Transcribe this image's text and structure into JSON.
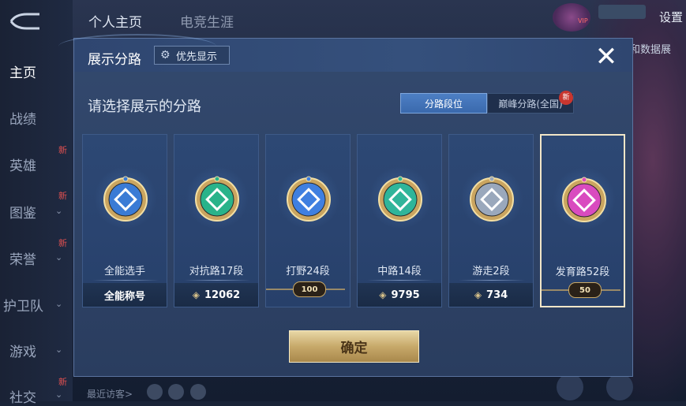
{
  "background": {
    "top_tabs": [
      "个人主页",
      "电竞生涯"
    ],
    "settings_label": "设置",
    "vip_label": "VIP",
    "data_peek": "和数据展",
    "recent_visitors": "最近访客>",
    "nav": [
      {
        "label": "主页",
        "active": true
      },
      {
        "label": "战绩"
      },
      {
        "label": "英雄",
        "new": "新"
      },
      {
        "label": "图鉴",
        "new": "新",
        "chevron": true
      },
      {
        "label": "荣誉",
        "new": "新",
        "chevron": true
      },
      {
        "label": "护卫队",
        "chevron": true
      },
      {
        "label": "游戏",
        "chevron": true
      },
      {
        "label": "社交",
        "new": "新",
        "chevron": true
      }
    ]
  },
  "dialog": {
    "title": "展示分路",
    "priority_label": "优先显示",
    "close_symbol": "✕",
    "subtitle": "请选择展示的分路",
    "toggle": {
      "active": "分路段位",
      "inactive": "巅峰分路(全国)",
      "new_badge": "新"
    },
    "confirm_label": "确定",
    "cards": [
      {
        "name": "全能选手",
        "footer": "全能称号",
        "type": "text",
        "color": "#3a7bd5"
      },
      {
        "name": "对抗路17段",
        "footer": "12062",
        "type": "points",
        "color": "#29b38a"
      },
      {
        "name": "打野24段",
        "footer": "100",
        "type": "badge",
        "color": "#3f7fe0"
      },
      {
        "name": "中路14段",
        "footer": "9795",
        "type": "points",
        "color": "#2fb59a"
      },
      {
        "name": "游走2段",
        "footer": "734",
        "type": "points",
        "color": "#9aa8bc"
      },
      {
        "name": "发育路52段",
        "footer": "50",
        "type": "badge",
        "color": "#d94bbf",
        "selected": true
      }
    ]
  }
}
